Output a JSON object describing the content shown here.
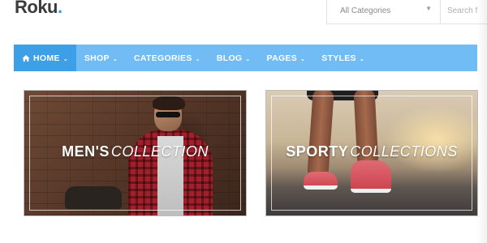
{
  "header": {
    "logo_text": "Roku",
    "logo_dot": ".",
    "category_select": {
      "value": "All Categories"
    },
    "search": {
      "placeholder": "Search f"
    }
  },
  "nav": {
    "items": [
      {
        "label": "HOME",
        "icon": "home-icon",
        "active": true
      },
      {
        "label": "SHOP"
      },
      {
        "label": "CATEGORIES"
      },
      {
        "label": "BLOG"
      },
      {
        "label": "PAGES"
      },
      {
        "label": "STYLES"
      }
    ]
  },
  "banners": [
    {
      "strong": "MEN'S",
      "light": "COLLECTION"
    },
    {
      "strong": "SPORTY",
      "light": "COLLECTIONS"
    }
  ],
  "colors": {
    "nav_bg": "#72bcf5",
    "nav_active": "#3d9fe6",
    "logo_dot": "#2a9de8"
  }
}
